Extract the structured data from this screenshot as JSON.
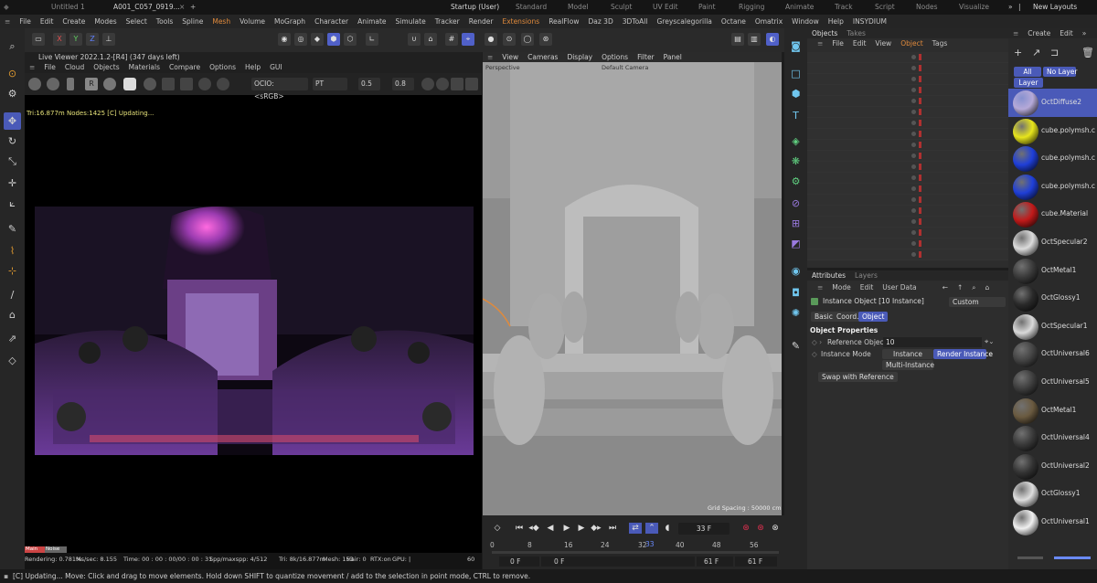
{
  "tabs": [
    {
      "label": "Untitled 1"
    },
    {
      "label": "A001_C057_0919..."
    },
    {
      "label": "Startup (User)"
    },
    {
      "label": "Standard"
    },
    {
      "label": "Model"
    },
    {
      "label": "Sculpt"
    },
    {
      "label": "UV Edit"
    },
    {
      "label": "Paint"
    },
    {
      "label": "Rigging"
    },
    {
      "label": "Animate"
    },
    {
      "label": "Track"
    },
    {
      "label": "Script"
    },
    {
      "label": "Nodes"
    },
    {
      "label": "Visualize"
    },
    {
      "label": "New Layouts"
    }
  ],
  "menubar": [
    "File",
    "Edit",
    "Create",
    "Modes",
    "Select",
    "Tools",
    "Spline",
    "Mesh",
    "Volume",
    "MoGraph",
    "Character",
    "Animate",
    "Simulate",
    "Tracker",
    "Render",
    "Extensions",
    "RealFlow",
    "Daz 3D",
    "3DToAll",
    "Greyscalegorilla",
    "Octane",
    "Omatrix",
    "Window",
    "Help",
    "INSYDIUM"
  ],
  "toolbar": {
    "axes": [
      "X",
      "Y",
      "Z"
    ]
  },
  "liveviewer": {
    "title": "Live Viewer 2022.1.2-[R4] (347 days left)",
    "menu": [
      "File",
      "Cloud",
      "Objects",
      "Materials",
      "Compare",
      "Options",
      "Help",
      "GUI"
    ],
    "ocio": "OCIO: <sRGB>",
    "mode": "PT",
    "val1": "0.5",
    "val2": "0.8",
    "status": "Tri:16.877m Nodes:1425  [C] Updating...",
    "badge_main": "Main",
    "badge_noise": "Noise",
    "footer": {
      "rendering": "Rendering: 0.781%",
      "mssec": "Ms/sec: 8.155",
      "time": "Time: 00 : 00 : 00/00 : 00 : 31",
      "spp": "Spp/maxspp: 4/512",
      "tri": "Tri: 8k/16.877m",
      "mesh": "Mesh: 153",
      "hair": "Hair: 0",
      "rtx": "RTX:on",
      "gpu": "GPU: |",
      "gpuval": "60"
    }
  },
  "viewport": {
    "menu": [
      "View",
      "Cameras",
      "Display",
      "Options",
      "Filter",
      "Panel"
    ],
    "label_left": "Perspective",
    "label_center": "Default Camera",
    "grid": "Grid Spacing : 50000 cm"
  },
  "timeline": {
    "frame": "33 F",
    "ticks": [
      "0",
      "8",
      "16",
      "24",
      "32",
      "40",
      "48",
      "56"
    ],
    "current": "33",
    "start": "0 F",
    "start2": "0 F",
    "end": "61 F",
    "end2": "61 F"
  },
  "objects": {
    "tabs": [
      "Objects",
      "Takes"
    ],
    "menu": [
      "File",
      "Edit",
      "View",
      "Object",
      "Tags"
    ]
  },
  "attributes": {
    "tabs": [
      "Attributes",
      "Layers"
    ],
    "menu": [
      "Mode",
      "Edit",
      "User Data"
    ],
    "object_title": "Instance Object [10 Instance]",
    "preset": "Custom",
    "subtabs": [
      "Basic",
      "Coord.",
      "Object"
    ],
    "section": "Object Properties",
    "ref_label": "Reference Object",
    "ref_value": "10",
    "mode_label": "Instance Mode",
    "mode_options": [
      "Instance",
      "Render Instance",
      "Multi-Instance"
    ],
    "swap": "Swap with Reference"
  },
  "materials": {
    "menu": [
      "Create",
      "Edit"
    ],
    "filters": [
      "All",
      "No Layer",
      "Layer"
    ],
    "items": [
      {
        "name": "OctDiffuse2",
        "color": "#b5a9d8"
      },
      {
        "name": "cube.polymsh.c",
        "color": "#e7e51c"
      },
      {
        "name": "cube.polymsh.c",
        "color": "#1f3fd8"
      },
      {
        "name": "cube.polymsh.c",
        "color": "#1f3fd8"
      },
      {
        "name": "cube.Material",
        "color": "#c11a1a"
      },
      {
        "name": "OctSpecular2",
        "color": "#dcdcdc"
      },
      {
        "name": "OctMetal1",
        "color": "#3a3a3a"
      },
      {
        "name": "OctGlossy1",
        "color": "#2a2a2a"
      },
      {
        "name": "OctSpecular1",
        "color": "#d9d9d9"
      },
      {
        "name": "OctUniversal6",
        "color": "#444444"
      },
      {
        "name": "OctUniversal5",
        "color": "#3e3e3e"
      },
      {
        "name": "OctMetal1",
        "color": "#6a5a40"
      },
      {
        "name": "OctUniversal4",
        "color": "#3a3a3a"
      },
      {
        "name": "OctUniversal2",
        "color": "#333333"
      },
      {
        "name": "OctGlossy1",
        "color": "#dedede"
      },
      {
        "name": "OctUniversal1",
        "color": "#f0f0f0"
      }
    ]
  },
  "statusbar": "[C] Updating...  Move: Click and drag to move elements. Hold down SHIFT to quantize movement / add to the selection in point mode, CTRL to remove."
}
